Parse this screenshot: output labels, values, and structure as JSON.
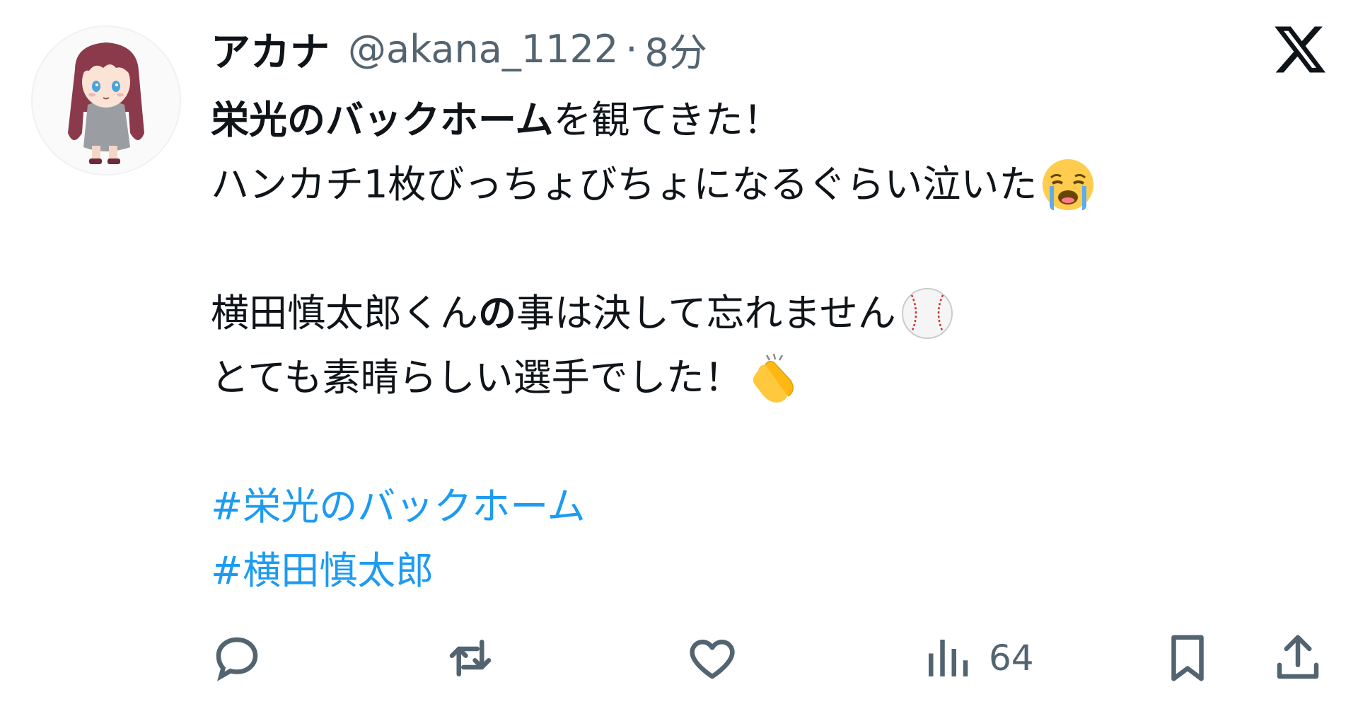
{
  "user": {
    "display_name": "アカナ",
    "handle": "@akana_1122",
    "separator": "·",
    "time": "8分"
  },
  "tweet": {
    "line1_bold": "栄光のバックホーム",
    "line1_rest": "を観てきた！",
    "line2": "ハンカチ1枚びっちょびちょになるぐらい泣いた",
    "line3_a": "横田慎太郎くん",
    "line3_b": "の",
    "line3_c": "事は決して忘れません",
    "line4": "とても素晴らしい選手でした！",
    "hashtag1": "#栄光のバックホーム",
    "hashtag2": "#横田慎太郎"
  },
  "icons": {
    "avatar": "anime-girl-avatar",
    "logo": "x-logo-icon",
    "emoji1": "loudly-crying-face-emoji",
    "emoji2": "baseball-emoji",
    "emoji3": "clapping-hands-emoji",
    "reply": "reply-icon",
    "retweet": "retweet-icon",
    "like": "like-icon",
    "views": "views-icon",
    "bookmark": "bookmark-icon",
    "share": "share-icon"
  },
  "actions": {
    "views_count": "64"
  },
  "colors": {
    "text": "#0f1419",
    "secondary": "#536471",
    "hashtag": "#1d9bf0"
  }
}
